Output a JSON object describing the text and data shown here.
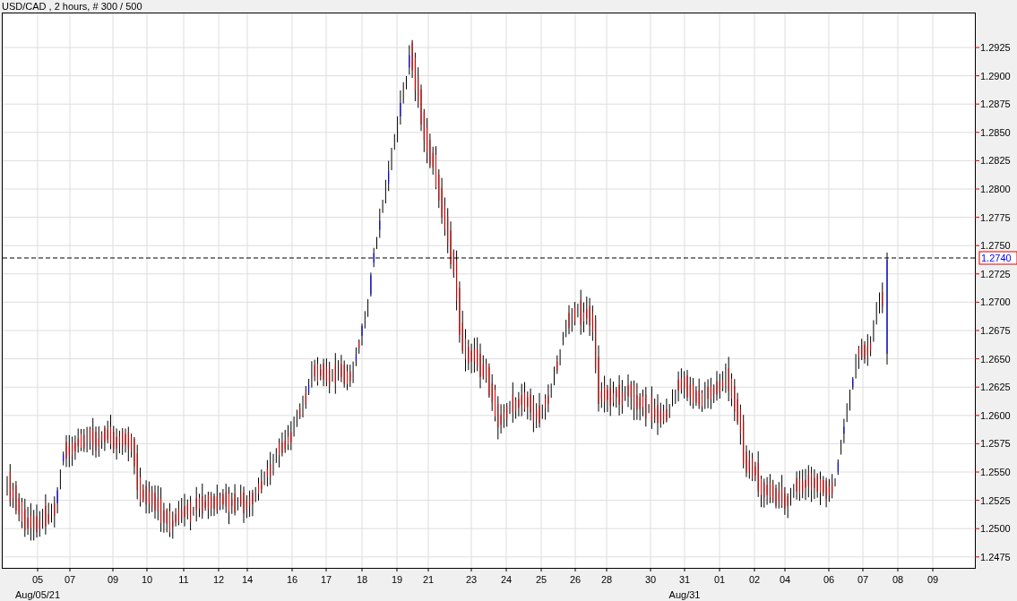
{
  "chart_title": "USD/CAD , 2 hours, # 300 / 500",
  "price_axis": {
    "ticks": [
      "1.2925",
      "1.2900",
      "1.2875",
      "1.2850",
      "1.2825",
      "1.2800",
      "1.2775",
      "1.2750",
      "1.2725",
      "1.2700",
      "1.2675",
      "1.2650",
      "1.2625",
      "1.2600",
      "1.2575",
      "1.2550",
      "1.2525",
      "1.2500",
      "1.2475"
    ],
    "current_price": "1.2740"
  },
  "time_axis": {
    "labels": [
      "05",
      "07",
      "09",
      "10",
      "11",
      "12",
      "14",
      "16",
      "17",
      "18",
      "19",
      "21",
      "23",
      "24",
      "25",
      "26",
      "28",
      "30",
      "31",
      "01",
      "02",
      "04",
      "06",
      "07",
      "08",
      "09"
    ],
    "period_labels": [
      "Aug/05/21",
      "Aug/31"
    ]
  }
}
